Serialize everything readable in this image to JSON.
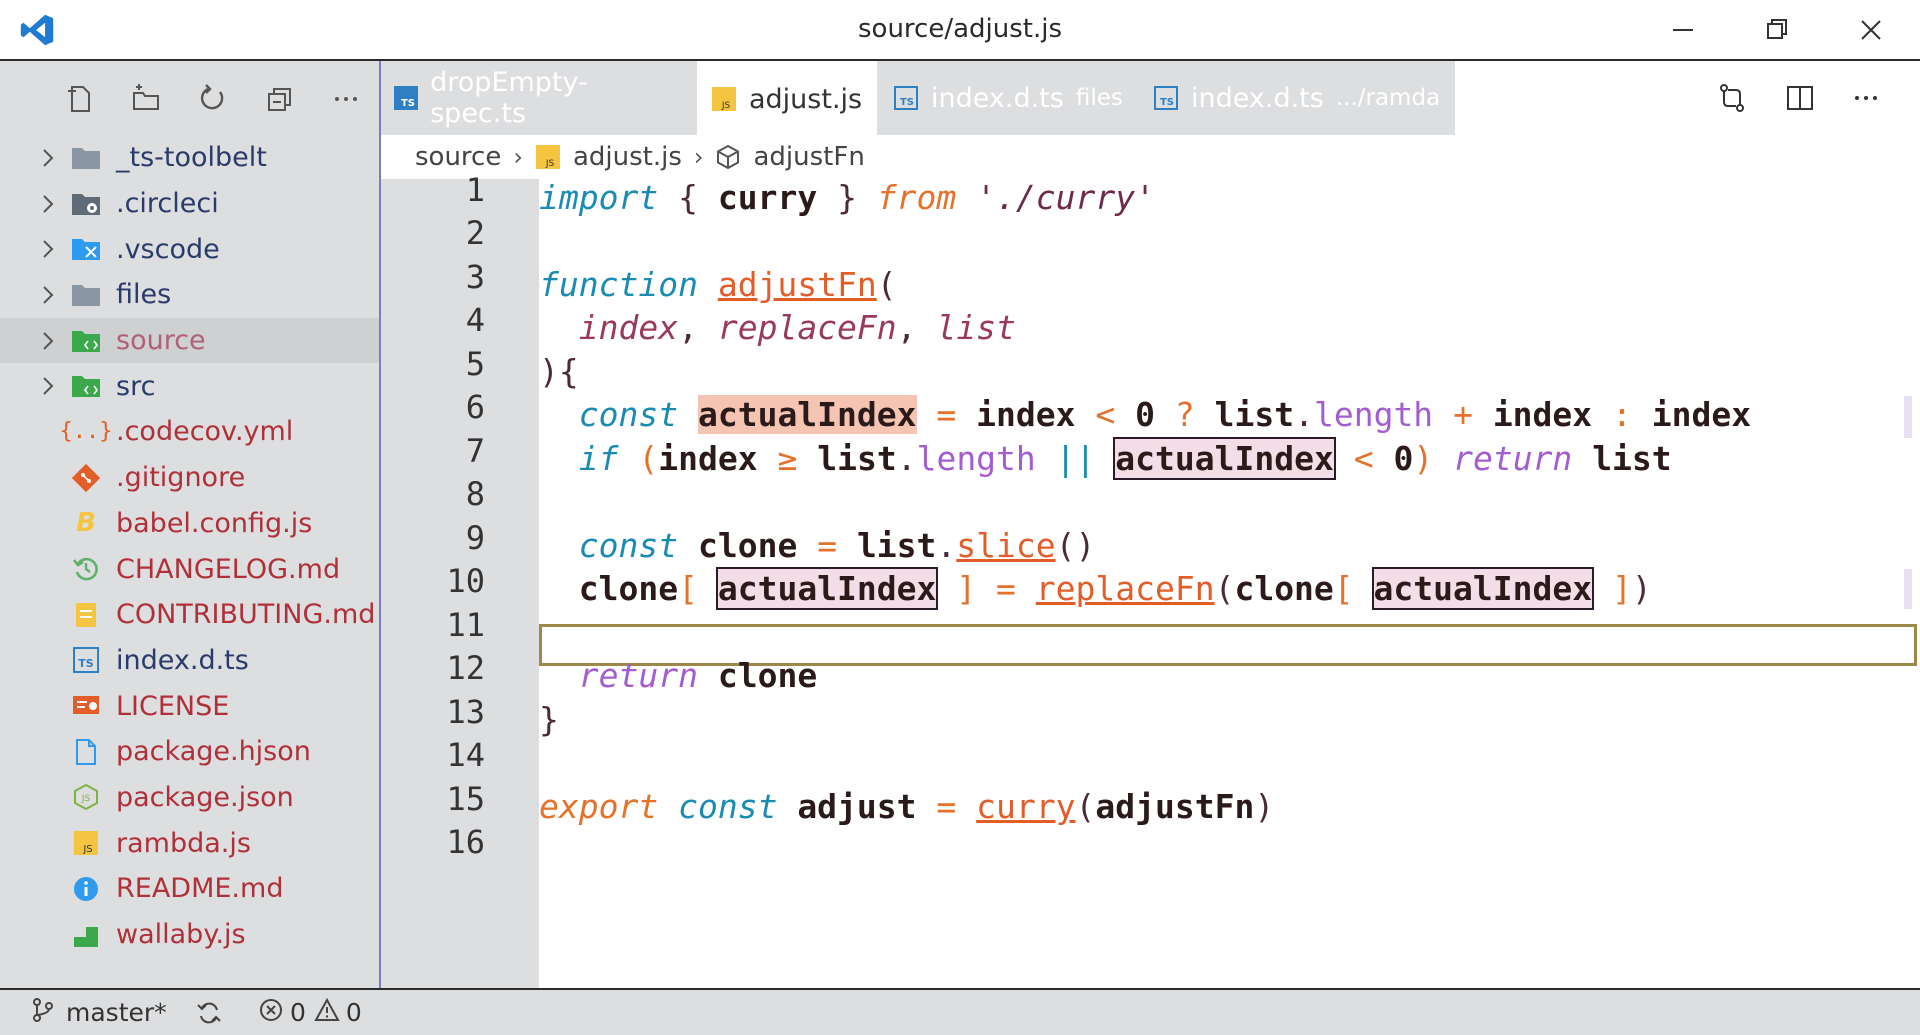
{
  "window": {
    "title": "source/adjust.js"
  },
  "sidebar": {
    "items": [
      {
        "label": "_ts-toolbelt",
        "folder": true,
        "icon": "folder-icon",
        "color": "#8a97a3"
      },
      {
        "label": ".circleci",
        "folder": true,
        "icon": "circleci-folder-icon",
        "color": "#5f6b76"
      },
      {
        "label": ".vscode",
        "folder": true,
        "icon": "vscode-folder-icon",
        "color": "#2f9bf0"
      },
      {
        "label": "files",
        "folder": true,
        "icon": "folder-icon",
        "color": "#8a97a3"
      },
      {
        "label": "source",
        "folder": true,
        "icon": "source-folder-icon",
        "color": "#3aa84b",
        "selected": true
      },
      {
        "label": "src",
        "folder": true,
        "icon": "source-folder-icon",
        "color": "#3aa84b"
      },
      {
        "label": ".codecov.yml",
        "folder": false,
        "icon": "yaml-icon",
        "color": "#e25d28"
      },
      {
        "label": ".gitignore",
        "folder": false,
        "icon": "git-icon",
        "color": "#e25d28"
      },
      {
        "label": "babel.config.js",
        "folder": false,
        "icon": "babel-icon",
        "color": "#f5c542"
      },
      {
        "label": "CHANGELOG.md",
        "folder": false,
        "icon": "changelog-icon",
        "color": "#5fb06a"
      },
      {
        "label": "CONTRIBUTING.md",
        "folder": false,
        "icon": "contributing-icon",
        "color": "#f5c542"
      },
      {
        "label": "index.d.ts",
        "folder": false,
        "icon": "typescript-icon",
        "color": "#2f7fc4"
      },
      {
        "label": "LICENSE",
        "folder": false,
        "icon": "license-icon",
        "color": "#e25d28"
      },
      {
        "label": "package.hjson",
        "folder": false,
        "icon": "file-icon",
        "color": "#2f9bf0"
      },
      {
        "label": "package.json",
        "folder": false,
        "icon": "nodejs-icon",
        "color": "#7cb342"
      },
      {
        "label": "rambda.js",
        "folder": false,
        "icon": "javascript-icon",
        "color": "#f5c542"
      },
      {
        "label": "README.md",
        "folder": false,
        "icon": "info-icon",
        "color": "#2f9bf0"
      },
      {
        "label": "wallaby.js",
        "folder": false,
        "icon": "wallaby-icon",
        "color": "#3aa84b"
      }
    ]
  },
  "tabs": [
    {
      "label": "dropEmpty-spec.ts",
      "sub": "",
      "icon": "typescript-icon"
    },
    {
      "label": "adjust.js",
      "sub": "",
      "icon": "javascript-icon",
      "active": true
    },
    {
      "label": "index.d.ts",
      "sub": "files",
      "icon": "typescript-icon"
    },
    {
      "label": "index.d.ts",
      "sub": ".../ramda",
      "icon": "typescript-icon"
    }
  ],
  "breadcrumb": {
    "folder": "source",
    "file": "adjust.js",
    "symbol": "adjustFn"
  },
  "editor": {
    "line_numbers": [
      "1",
      "2",
      "3",
      "4",
      "5",
      "6",
      "7",
      "8",
      "9",
      "10",
      "11",
      "12",
      "13",
      "14",
      "15",
      "16"
    ]
  },
  "status": {
    "branch": "master*",
    "errors": "0",
    "warnings": "0"
  },
  "colors": {
    "sidebar_bg": "#dddee0",
    "accent_border": "#7b7fc0",
    "current_line_border": "#9d8848"
  }
}
